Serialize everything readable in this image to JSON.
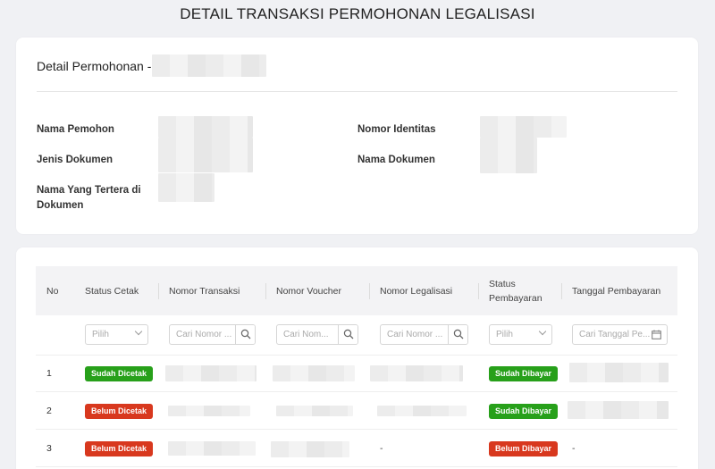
{
  "page": {
    "title": "DETAIL TRANSAKSI PERMOHONAN LEGALISASI"
  },
  "detail": {
    "heading": "Detail Permohonan -",
    "labels": {
      "nama_pemohon": "Nama Pemohon",
      "jenis_dokumen": "Jenis Dokumen",
      "nama_yang_tertera": "Nama Yang Tertera di Dokumen",
      "nomor_identitas": "Nomor Identitas",
      "nama_dokumen": "Nama Dokumen"
    }
  },
  "table": {
    "headers": [
      "No",
      "Status Cetak",
      "Nomor Transaksi",
      "Nomor Voucher",
      "Nomor Legalisasi",
      "Status Pembayaran",
      "Tanggal Pembayaran"
    ],
    "filters": {
      "status_cetak": "Pilih",
      "nomor_transaksi": "Cari Nomor ...",
      "nomor_voucher": "Cari Nom...",
      "nomor_legalisasi": "Cari Nomor ...",
      "status_pembayaran": "Pilih",
      "tanggal_pembayaran": "Cari Tanggal Pe..."
    },
    "rows": [
      {
        "no": "1",
        "status_cetak": "Sudah Dicetak",
        "status_pembayaran": "Sudah Dibayar",
        "legalisasi": "",
        "tanggal": ""
      },
      {
        "no": "2",
        "status_cetak": "Belum Dicetak",
        "status_pembayaran": "Sudah Dibayar",
        "legalisasi": "",
        "tanggal": ""
      },
      {
        "no": "3",
        "status_cetak": "Belum Dicetak",
        "status_pembayaran": "Belum Dibayar",
        "legalisasi": "-",
        "tanggal": "-"
      }
    ]
  },
  "icons": {
    "search": "search-icon",
    "calendar": "calendar-icon",
    "dropdown": "chevron-down-icon"
  },
  "colors": {
    "badge_green": "#27a01a",
    "badge_red": "#d8381e"
  }
}
